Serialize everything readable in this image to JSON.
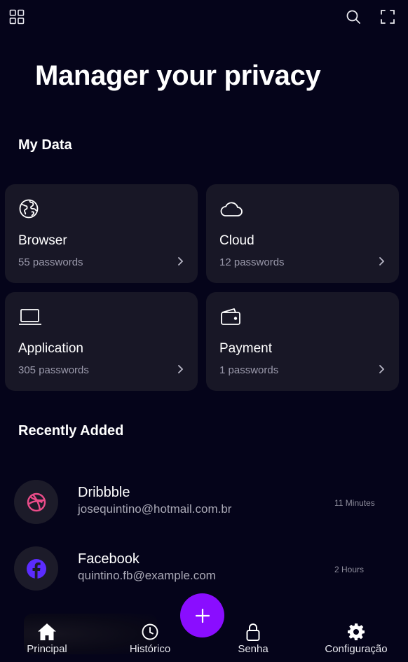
{
  "header": {
    "menu_icon": "grid-icon",
    "search_icon": "search-icon",
    "fullscreen_icon": "fullscreen-icon"
  },
  "title": "Manager your privacy",
  "my_data": {
    "heading": "My Data",
    "cards": [
      {
        "icon": "globe-icon",
        "title": "Browser",
        "subtitle": "55 passwords"
      },
      {
        "icon": "cloud-icon",
        "title": "Cloud",
        "subtitle": "12 passwords"
      },
      {
        "icon": "laptop-icon",
        "title": "Application",
        "subtitle": "305 passwords"
      },
      {
        "icon": "wallet-icon",
        "title": "Payment",
        "subtitle": "1 passwords"
      }
    ]
  },
  "recently_added": {
    "heading": "Recently Added",
    "items": [
      {
        "icon": "dribbble-icon",
        "name": "Dribbble",
        "email": "josequintino@hotmail.com.br",
        "time": "11 Minutes"
      },
      {
        "icon": "facebook-icon",
        "name": "Facebook",
        "email": "quintino.fb@example.com",
        "time": "2 Hours"
      }
    ]
  },
  "bottom_nav": {
    "items": [
      {
        "icon": "home-icon",
        "label": "Principal"
      },
      {
        "icon": "clock-icon",
        "label": "Histórico"
      },
      {
        "icon": "lock-icon",
        "label": "Senha"
      },
      {
        "icon": "gear-icon",
        "label": "Configuração"
      }
    ]
  },
  "fab": {
    "icon": "plus-icon"
  },
  "colors": {
    "background": "#05041a",
    "card": "#181726",
    "accent": "#8a0dff",
    "dribbble": "#ea4c89",
    "facebook": "#5b2cff"
  }
}
